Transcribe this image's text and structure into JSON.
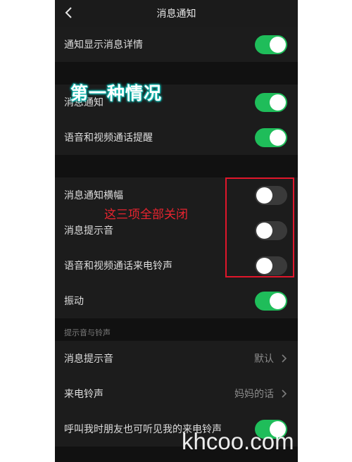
{
  "nav": {
    "title": "消息通知",
    "back_icon": "chevron-left-icon"
  },
  "group1": {
    "rows": [
      {
        "label": "通知显示消息详情",
        "enabled": true
      }
    ]
  },
  "group2": {
    "rows": [
      {
        "label": "消息通知",
        "enabled": true
      },
      {
        "label": "语音和视频通话提醒",
        "enabled": true
      }
    ]
  },
  "group3": {
    "rows": [
      {
        "label": "消息通知横幅",
        "enabled": false
      },
      {
        "label": "消息提示音",
        "enabled": false
      },
      {
        "label": "语音和视频通话来电铃声",
        "enabled": false
      },
      {
        "label": "振动",
        "enabled": true
      }
    ]
  },
  "sounds": {
    "header": "提示音与铃声",
    "message_tone": {
      "label": "消息提示音",
      "value": "默认"
    },
    "ringtone": {
      "label": "来电铃声",
      "value": "妈妈的话"
    },
    "share_ringtone": {
      "label": "呼叫我时朋友也可听见我的来电铃声",
      "enabled": true
    }
  },
  "annotations": {
    "title": "第一种情况",
    "note": "这三项全部关闭",
    "watermark": "khcoo.com"
  },
  "colors": {
    "accent_on": "#1fbd5a",
    "toggle_off": "#3a3a3a",
    "annotation_red": "#e0162b",
    "title_glow": "#15b8b0"
  }
}
